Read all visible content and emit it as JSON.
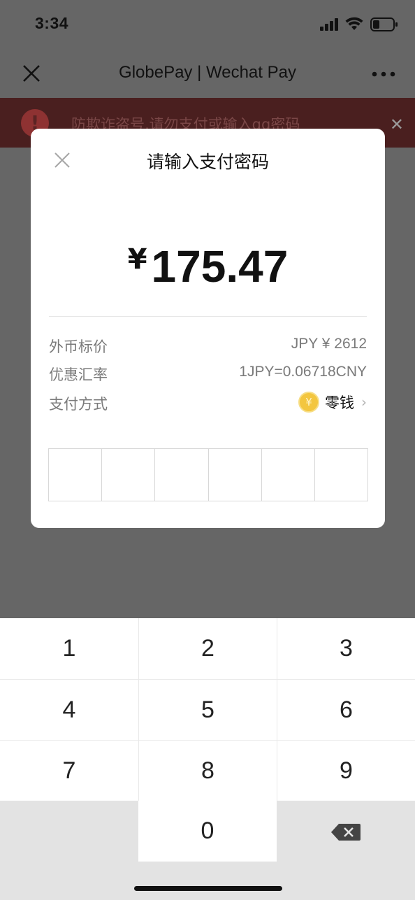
{
  "status_bar": {
    "time": "3:34"
  },
  "navbar": {
    "title": "GlobePay | Wechat Pay"
  },
  "banner": {
    "icon": "!",
    "text": "防欺诈盗号,请勿支付或输入qq密码",
    "close": "✕"
  },
  "dialog": {
    "title": "请输入支付密码",
    "currency_symbol": "¥",
    "amount": "175.47",
    "rows": [
      {
        "label": "外币标价",
        "value": "JPY ¥ 2612"
      },
      {
        "label": "优惠汇率",
        "value": "1JPY=0.06718CNY"
      },
      {
        "label": "支付方式",
        "value": "零钱"
      }
    ],
    "coin_glyph": "¥",
    "chevron": "›",
    "password_length": 6
  },
  "keypad": {
    "keys": [
      "1",
      "2",
      "3",
      "4",
      "5",
      "6",
      "7",
      "8",
      "9",
      "0"
    ]
  },
  "colors": {
    "overlay": "#666666",
    "banner_bg": "#4a1f1f",
    "coin": "#f3c63f",
    "keypad_bg": "#ffffff",
    "keypad_gray": "#e3e3e3"
  }
}
